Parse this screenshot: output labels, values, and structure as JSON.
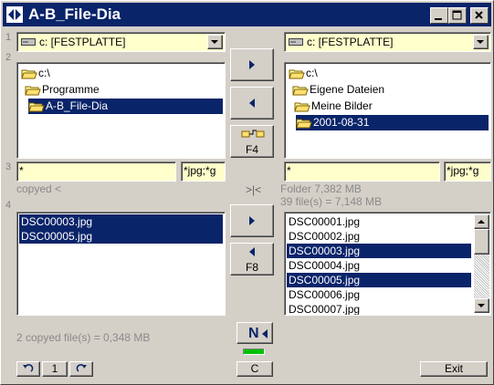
{
  "window": {
    "title": "A-B_File-Dia"
  },
  "row_numbers": [
    "1",
    "2",
    "3",
    "4"
  ],
  "left": {
    "drive": "c: [FESTPLATTE]",
    "tree": [
      {
        "label": "c:\\",
        "selected": false
      },
      {
        "label": "Programme",
        "selected": false
      },
      {
        "label": "A-B_File-Dia",
        "selected": true
      }
    ],
    "filter": "*",
    "mask": "*jpg;*g",
    "status_copied": "copyed <",
    "files": [
      "DSC00003.jpg",
      "DSC00005.jpg"
    ],
    "summary": "2  copyed file(s)  = 0,348  MB"
  },
  "right": {
    "drive": "c: [FESTPLATTE]",
    "tree": [
      {
        "label": "c:\\",
        "selected": false
      },
      {
        "label": "Eigene Dateien",
        "selected": false
      },
      {
        "label": "Meine Bilder",
        "selected": false
      },
      {
        "label": "2001-08-31",
        "selected": true
      }
    ],
    "filter": "*",
    "mask": "*jpg;*g",
    "folder_size": "Folder 7,382  MB",
    "file_count": "39  file(s)  = 7,148  MB",
    "files": [
      {
        "name": "DSC00001.jpg",
        "selected": false
      },
      {
        "name": "DSC00002.jpg",
        "selected": false
      },
      {
        "name": "DSC00003.jpg",
        "selected": true
      },
      {
        "name": "DSC00004.jpg",
        "selected": false
      },
      {
        "name": "DSC00005.jpg",
        "selected": true
      },
      {
        "name": "DSC00006.jpg",
        "selected": false
      },
      {
        "name": "DSC00007.jpg",
        "selected": false
      }
    ]
  },
  "middle": {
    "swap_label": ">|<",
    "f4_label": "F4",
    "f8_label": "F8",
    "n_label": "N",
    "c_label": "C"
  },
  "footer": {
    "page_number": "1",
    "exit_label": "Exit"
  },
  "colors": {
    "title_bar": "#0a246a",
    "selection": "#0a246a",
    "field_bg": "#ffffcc",
    "indicator_green": "#00c000"
  }
}
